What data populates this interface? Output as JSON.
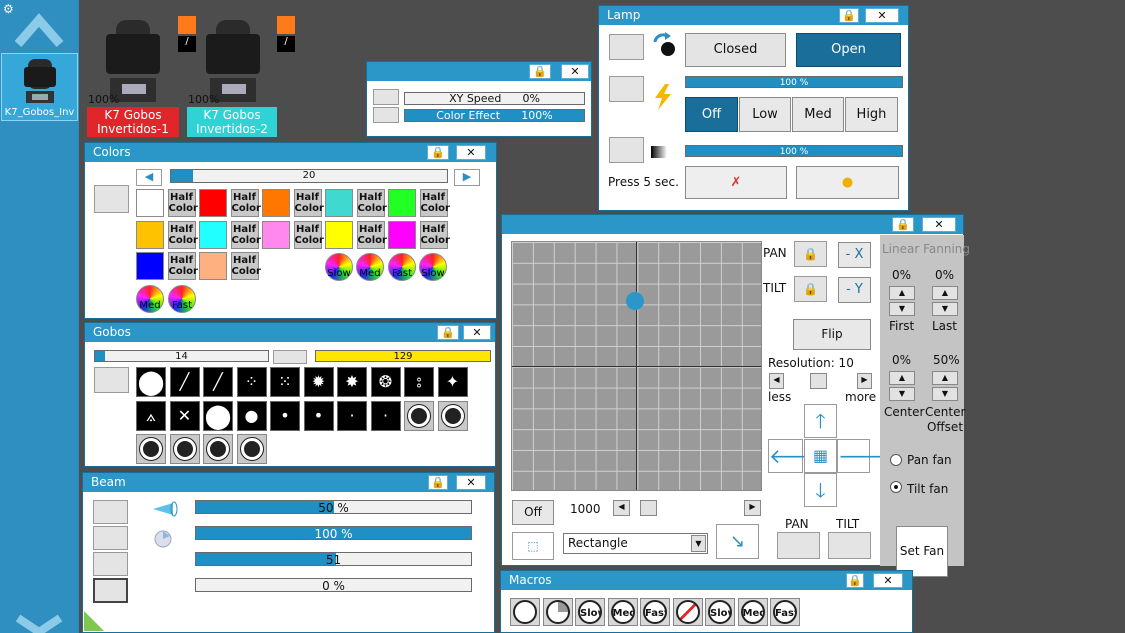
{
  "fixtures": {
    "group_label": "K7_Gobos_Inv",
    "items": [
      {
        "name": "K7 Gobos Invertidos-1",
        "intensity": "100%",
        "color": "#e0262b"
      },
      {
        "name": "K7 Gobos Invertidos-2",
        "intensity": "100%",
        "color": "#2fd3d6"
      }
    ]
  },
  "lamp": {
    "title": "Lamp",
    "closed": "Closed",
    "open": "Open",
    "bar1": "100 %",
    "bar2": "100 %",
    "levels": [
      "Off",
      "Low",
      "Med",
      "High"
    ],
    "press": "Press 5 sec."
  },
  "speed": {
    "xy_label": "XY Speed",
    "xy_value": "0%",
    "ce_label": "Color Effect",
    "ce_value": "100%",
    "xy_pct": 0,
    "ce_pct": 100
  },
  "colors": {
    "title": "Colors",
    "slider_value": "20",
    "half": "Half Color",
    "swatches": [
      "#ffffff",
      "#ff0000",
      "#ff7700",
      "#3fd9cf",
      "#22ff22",
      "#ffc200",
      "#22ffff",
      "#ff88ee",
      "#ffff00",
      "#ff00ff",
      "#0000ff",
      "#ffb080",
      "#ffcb9e"
    ],
    "effects": [
      "Slow",
      "Med",
      "Fast",
      "Slow",
      "Med",
      "Fast"
    ]
  },
  "gobos": {
    "title": "Gobos",
    "bar1": "14",
    "bar2": "129"
  },
  "beam": {
    "title": "Beam",
    "bars": [
      {
        "text": "50 %",
        "pct": 50
      },
      {
        "text": "100 %",
        "pct": 100
      },
      {
        "text": "51",
        "pct": 51
      },
      {
        "text": "0 %",
        "pct": 0
      }
    ]
  },
  "position": {
    "pan": "PAN",
    "tilt": "TILT",
    "neg_x": "- X",
    "neg_y": "- Y",
    "flip": "Flip",
    "resolution": "Resolution: 10",
    "less": "less",
    "more": "more",
    "off": "Off",
    "speed_value": "1000",
    "shape": "Rectangle",
    "pan_bottom": "PAN",
    "tilt_bottom": "TILT",
    "fanning_title": "Linear Fanning",
    "first_pct": "0%",
    "last_pct": "0%",
    "first": "First",
    "last": "Last",
    "center_pct": "0%",
    "offset_pct": "50%",
    "center": "Center",
    "center_offset": "Center Offset",
    "pan_fan": "Pan fan",
    "tilt_fan": "Tilt fan",
    "set_fan": "Set Fan"
  },
  "macros": {
    "title": "Macros",
    "items": [
      "",
      "",
      "Slow",
      "Med",
      "Fast",
      "",
      "Slow",
      "Med",
      "Fast"
    ]
  },
  "icons": {
    "settings": "gear-icon",
    "lock": "lock-icon",
    "close": "close-icon"
  }
}
